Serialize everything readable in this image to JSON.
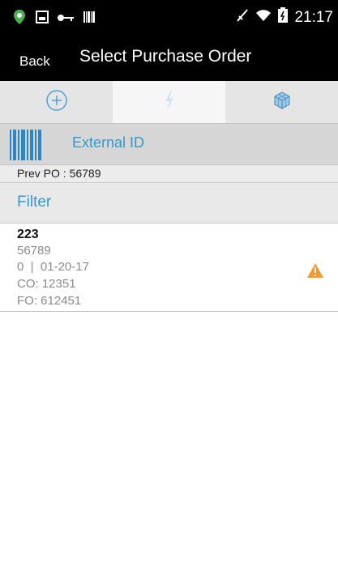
{
  "status_bar": {
    "time": "21:17",
    "icons_left": [
      "location-icon",
      "image-icon",
      "key-icon",
      "barcode-icon"
    ],
    "icons_right": [
      "signal-icon",
      "wifi-icon",
      "battery-icon"
    ]
  },
  "header": {
    "back_label": "Back",
    "title": "Select Purchase Order"
  },
  "tabs": [
    {
      "icon": "add-icon",
      "active": false
    },
    {
      "icon": "lightning-icon",
      "active": true
    },
    {
      "icon": "cube-icon",
      "active": false
    }
  ],
  "scan": {
    "icon": "barcode-icon",
    "label": "External ID"
  },
  "prev_po": "Prev PO : 56789",
  "filter_label": "Filter",
  "colors": {
    "accent": "#3399cc",
    "warning": "#f29a2e"
  },
  "orders": [
    {
      "title": "223",
      "po": "56789",
      "status_date": "0  |  01-20-17",
      "co": "CO: 12351",
      "fo": "FO: 612451",
      "warning_icon": "warning-icon"
    }
  ]
}
